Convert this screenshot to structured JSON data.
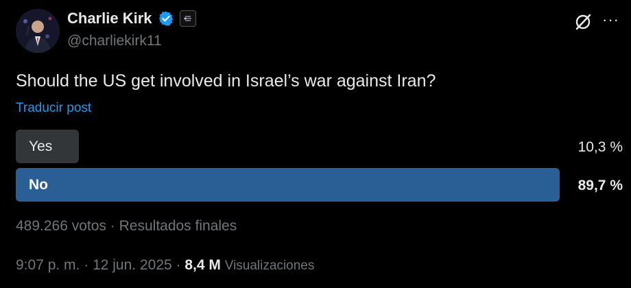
{
  "author": {
    "name": "Charlie Kirk",
    "handle": "@charliekirk11",
    "verified": true
  },
  "post": {
    "text": "Should the US get involved in Israel’s war against Iran?",
    "translate_label": "Traducir post"
  },
  "poll": {
    "options": [
      {
        "label": "Yes",
        "percent_text": "10,3 %",
        "percent": 10.3,
        "winner": false
      },
      {
        "label": "No",
        "percent_text": "89,7 %",
        "percent": 89.7,
        "winner": true
      }
    ],
    "votes_text": "489.266 votos",
    "separator": "·",
    "status_text": "Resultados finales"
  },
  "timestamp": {
    "time": "9:07 p. m.",
    "date": "12 jun. 2025",
    "views_count": "8,4 M",
    "views_label": "Visualizaciones"
  },
  "icons": {
    "verified": "verified-badge-icon",
    "affiliation": "affiliation-badge-icon",
    "grok": "grok-icon",
    "more": "more-icon"
  },
  "colors": {
    "background": "#000000",
    "accent": "#1d9bf0",
    "winner_bar": "#2a5f95",
    "loser_bar": "#333639",
    "secondary_text": "#71767b"
  }
}
